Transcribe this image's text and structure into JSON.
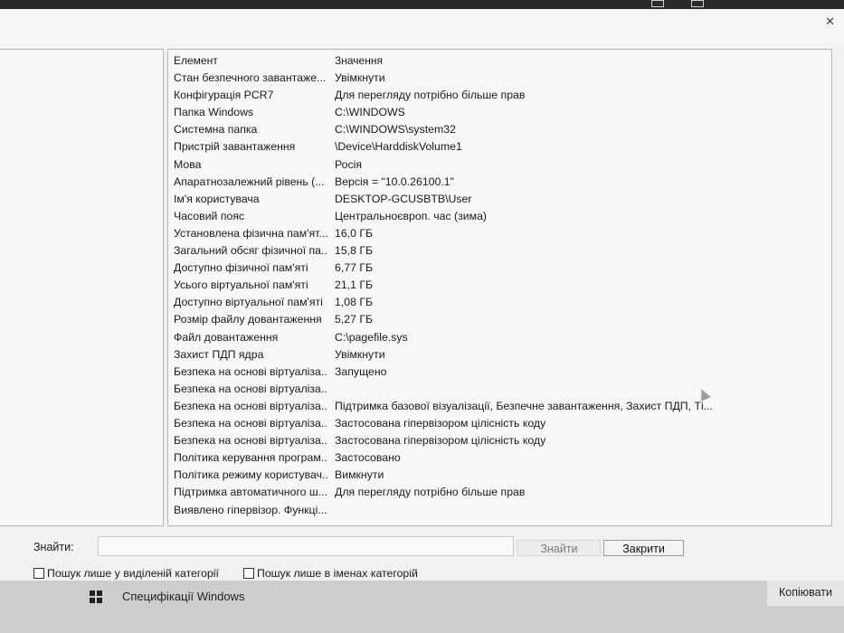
{
  "table": {
    "headers": {
      "element": "Елемент",
      "value": "Значення"
    },
    "rows": [
      [
        "Стан безпечного завантаже...",
        "Увімкнути"
      ],
      [
        "Конфігурація PCR7",
        "Для перегляду потрібно більше прав"
      ],
      [
        "Папка Windows",
        "C:\\WINDOWS"
      ],
      [
        "Системна папка",
        "C:\\WINDOWS\\system32"
      ],
      [
        "Пристрій завантаження",
        "\\Device\\HarddiskVolume1"
      ],
      [
        "Мова",
        "Росія"
      ],
      [
        "Апаратнозалежний рівень (...",
        "Версія = \"10.0.26100.1\""
      ],
      [
        "Ім'я користувача",
        "DESKTOP-GCUSBTB\\User"
      ],
      [
        "Часовий пояс",
        "Центральноєвроп. час (зима)"
      ],
      [
        "Установлена фізична пам'ят...",
        "16,0 ГБ"
      ],
      [
        "Загальний обсяг фізичної па...",
        "15,8 ГБ"
      ],
      [
        "Доступно фізичної пам'яті",
        "6,77 ГБ"
      ],
      [
        "Усього віртуальної пам'яті",
        "21,1 ГБ"
      ],
      [
        "Доступно віртуальної пам'яті",
        "1,08 ГБ"
      ],
      [
        "Розмір файлу довантаження",
        "5,27 ГБ"
      ],
      [
        "Файл довантаження",
        "C:\\pagefile.sys"
      ],
      [
        "Захист ПДП ядра",
        "Увімкнути"
      ],
      [
        "Безпека на основі віртуаліза...",
        "Запущено"
      ],
      [
        "Безпека на основі віртуаліза...",
        ""
      ],
      [
        "Безпека на основі віртуаліза...",
        "Підтримка базової візуалізації, Безпечне завантаження, Захист ПДП, Ті..."
      ],
      [
        "Безпека на основі віртуаліза...",
        "Застосована гіпервізором цілісність коду"
      ],
      [
        "Безпека на основі віртуаліза...",
        "Застосована гіпервізором цілісність коду"
      ],
      [
        "Політика керування програм...",
        "Застосовано"
      ],
      [
        "Політика режиму користувач...",
        "Вимкнути"
      ],
      [
        "Підтримка автоматичного ш...",
        "Для перегляду потрібно більше прав"
      ],
      [
        "Виявлено гіпервізор. Функці...",
        ""
      ]
    ]
  },
  "find": {
    "label": "Знайти:",
    "input_value": "",
    "find_button": "Знайти",
    "close_button": "Закрити",
    "check_selected_category": "Пошук лише у виділеній категорії",
    "check_category_names": "Пошук лише в іменах категорій"
  },
  "taskbar": {
    "spec_label": "Специфікації Windows",
    "copy_button": "Копіювати"
  },
  "icons": [
    "windows-logo-icon",
    "close-icon",
    "mouse-cursor-icon"
  ]
}
